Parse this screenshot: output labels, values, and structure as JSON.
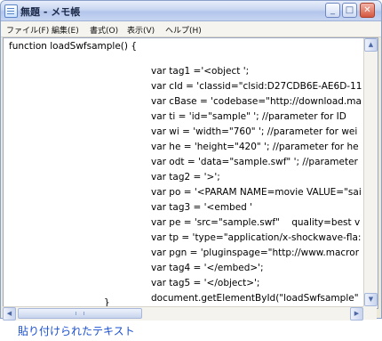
{
  "window": {
    "title": "無題 - メモ帳",
    "buttons": {
      "minimize": "_",
      "maximize": "□",
      "close": "✕"
    }
  },
  "menubar": [
    "ファイル(F)",
    "編集(E)",
    "書式(O)",
    "表示(V)",
    "ヘルプ(H)"
  ],
  "editor": {
    "lines": [
      "function loadSwfsample() {",
      "var tag1 ='<object ';",
      "var cId = 'classid=\"clsid:D27CDB6E-AE6D-11",
      "var cBase = 'codebase=\"http://download.ma",
      "var ti = 'id=\"sample\" '; //parameter for ID",
      "var wi = 'width=\"760\" '; //parameter for wei",
      "var he = 'height=\"420\" '; //parameter for he",
      "var odt = 'data=\"sample.swf\" '; //parameter",
      "var tag2 = '>';",
      "var po = '<PARAM NAME=movie VALUE=\"sai",
      "var tag3 = '<embed '",
      "var pe = 'src=\"sample.swf\"    quality=best v",
      "var tp = 'type=\"application/x-shockwave-fla:",
      "var pgn = 'pluginspage=\"http://www.macror",
      "var tag4 = '</embed>';",
      "var tag5 = '</object>';",
      "document.getElementById(\"loadSwfsample\"",
      "}"
    ]
  },
  "scrollbars": {
    "up": "▲",
    "down": "▼",
    "left": "◀",
    "right": "▶"
  },
  "caption": "貼り付けられたテキスト"
}
